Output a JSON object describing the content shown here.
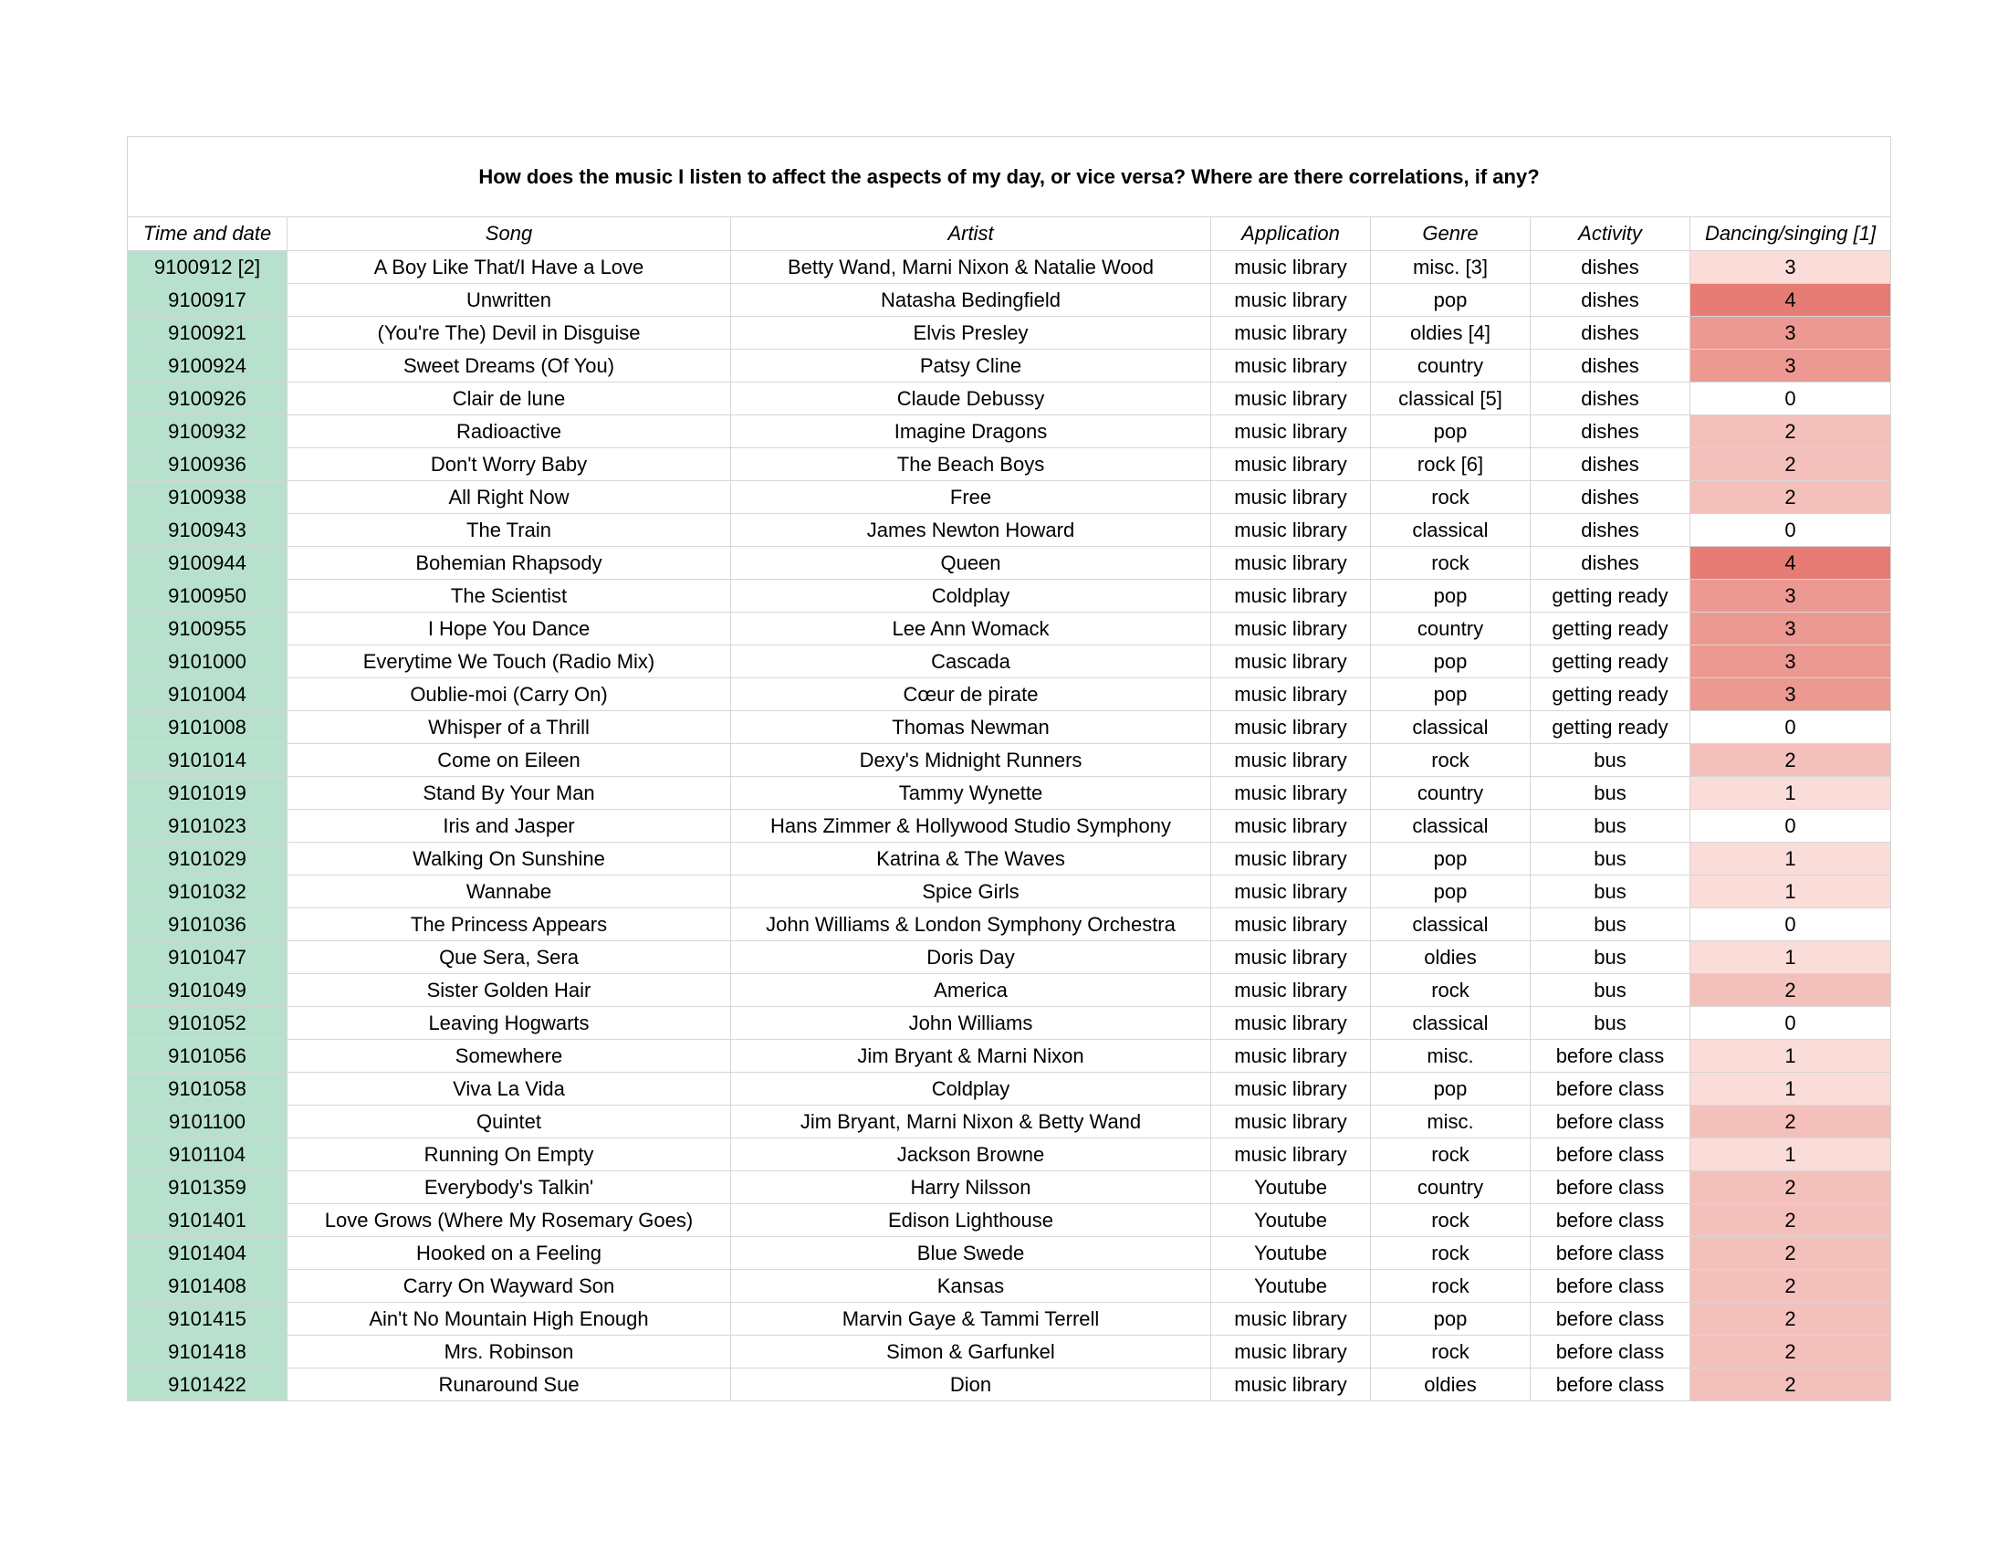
{
  "title": "How does the music I listen to affect the aspects of my day, or vice versa? Where are there correlations, if any?",
  "columns": [
    "Time and date",
    "Song",
    "Artist",
    "Application",
    "Genre",
    "Activity",
    "Dancing/singing [1]"
  ],
  "colors": {
    "time_column_fill": "#b7e1cd",
    "dance_scale": {
      "0": "#ffffff",
      "1": "#fadcd9",
      "2": "#f4c0bc",
      "3": "#ec9992",
      "4": "#e67c73"
    }
  },
  "rows": [
    {
      "time": "9100912 [2]",
      "song": "A Boy Like That/I Have a Love",
      "artist": "Betty Wand, Marni Nixon & Natalie Wood",
      "application": "music library",
      "genre": "misc. [3]",
      "activity": "dishes",
      "dance": 3,
      "dance_fill": "#fadcd9"
    },
    {
      "time": "9100917",
      "song": "Unwritten",
      "artist": "Natasha Bedingfield",
      "application": "music library",
      "genre": "pop",
      "activity": "dishes",
      "dance": 4,
      "dance_fill": "#e67c73"
    },
    {
      "time": "9100921",
      "song": "(You're The) Devil in Disguise",
      "artist": "Elvis Presley",
      "application": "music library",
      "genre": "oldies [4]",
      "activity": "dishes",
      "dance": 3,
      "dance_fill": "#ec9992"
    },
    {
      "time": "9100924",
      "song": "Sweet Dreams (Of You)",
      "artist": "Patsy Cline",
      "application": "music library",
      "genre": "country",
      "activity": "dishes",
      "dance": 3,
      "dance_fill": "#ec9992"
    },
    {
      "time": "9100926",
      "song": "Clair de lune",
      "artist": "Claude Debussy",
      "application": "music library",
      "genre": "classical [5]",
      "activity": "dishes",
      "dance": 0,
      "dance_fill": "#ffffff"
    },
    {
      "time": "9100932",
      "song": "Radioactive",
      "artist": "Imagine Dragons",
      "application": "music library",
      "genre": "pop",
      "activity": "dishes",
      "dance": 2,
      "dance_fill": "#f4c0bc"
    },
    {
      "time": "9100936",
      "song": "Don't Worry Baby",
      "artist": "The Beach Boys",
      "application": "music library",
      "genre": "rock [6]",
      "activity": "dishes",
      "dance": 2,
      "dance_fill": "#f4c0bc"
    },
    {
      "time": "9100938",
      "song": "All Right Now",
      "artist": "Free",
      "application": "music library",
      "genre": "rock",
      "activity": "dishes",
      "dance": 2,
      "dance_fill": "#f4c0bc"
    },
    {
      "time": "9100943",
      "song": "The Train",
      "artist": "James Newton Howard",
      "application": "music library",
      "genre": "classical",
      "activity": "dishes",
      "dance": 0,
      "dance_fill": "#ffffff"
    },
    {
      "time": "9100944",
      "song": "Bohemian Rhapsody",
      "artist": "Queen",
      "application": "music library",
      "genre": "rock",
      "activity": "dishes",
      "dance": 4,
      "dance_fill": "#e67c73"
    },
    {
      "time": "9100950",
      "song": "The Scientist",
      "artist": "Coldplay",
      "application": "music library",
      "genre": "pop",
      "activity": "getting ready",
      "dance": 3,
      "dance_fill": "#ec9992"
    },
    {
      "time": "9100955",
      "song": "I Hope You Dance",
      "artist": "Lee Ann Womack",
      "application": "music library",
      "genre": "country",
      "activity": "getting ready",
      "dance": 3,
      "dance_fill": "#ec9992"
    },
    {
      "time": "9101000",
      "song": "Everytime We Touch (Radio Mix)",
      "artist": "Cascada",
      "application": "music library",
      "genre": "pop",
      "activity": "getting ready",
      "dance": 3,
      "dance_fill": "#ec9992"
    },
    {
      "time": "9101004",
      "song": "Oublie-moi (Carry On)",
      "artist": "Cœur de pirate",
      "application": "music library",
      "genre": "pop",
      "activity": "getting ready",
      "dance": 3,
      "dance_fill": "#ec9992"
    },
    {
      "time": "9101008",
      "song": "Whisper of a Thrill",
      "artist": "Thomas Newman",
      "application": "music library",
      "genre": "classical",
      "activity": "getting ready",
      "dance": 0,
      "dance_fill": "#ffffff"
    },
    {
      "time": "9101014",
      "song": "Come on Eileen",
      "artist": "Dexy's Midnight Runners",
      "application": "music library",
      "genre": "rock",
      "activity": "bus",
      "dance": 2,
      "dance_fill": "#f4c0bc"
    },
    {
      "time": "9101019",
      "song": "Stand By Your Man",
      "artist": "Tammy Wynette",
      "application": "music library",
      "genre": "country",
      "activity": "bus",
      "dance": 1,
      "dance_fill": "#fadcd9"
    },
    {
      "time": "9101023",
      "song": "Iris and Jasper",
      "artist": "Hans Zimmer & Hollywood Studio Symphony",
      "application": "music library",
      "genre": "classical",
      "activity": "bus",
      "dance": 0,
      "dance_fill": "#ffffff"
    },
    {
      "time": "9101029",
      "song": "Walking On Sunshine",
      "artist": "Katrina & The Waves",
      "application": "music library",
      "genre": "pop",
      "activity": "bus",
      "dance": 1,
      "dance_fill": "#fadcd9"
    },
    {
      "time": "9101032",
      "song": "Wannabe",
      "artist": "Spice Girls",
      "application": "music library",
      "genre": "pop",
      "activity": "bus",
      "dance": 1,
      "dance_fill": "#fadcd9"
    },
    {
      "time": "9101036",
      "song": "The Princess Appears",
      "artist": "John Williams & London Symphony Orchestra",
      "application": "music library",
      "genre": "classical",
      "activity": "bus",
      "dance": 0,
      "dance_fill": "#ffffff"
    },
    {
      "time": "9101047",
      "song": "Que Sera, Sera",
      "artist": "Doris Day",
      "application": "music library",
      "genre": "oldies",
      "activity": "bus",
      "dance": 1,
      "dance_fill": "#fadcd9"
    },
    {
      "time": "9101049",
      "song": "Sister Golden Hair",
      "artist": "America",
      "application": "music library",
      "genre": "rock",
      "activity": "bus",
      "dance": 2,
      "dance_fill": "#f4c0bc"
    },
    {
      "time": "9101052",
      "song": "Leaving Hogwarts",
      "artist": "John Williams",
      "application": "music library",
      "genre": "classical",
      "activity": "bus",
      "dance": 0,
      "dance_fill": "#ffffff"
    },
    {
      "time": "9101056",
      "song": "Somewhere",
      "artist": "Jim Bryant & Marni Nixon",
      "application": "music library",
      "genre": "misc.",
      "activity": "before class",
      "dance": 1,
      "dance_fill": "#fadcd9"
    },
    {
      "time": "9101058",
      "song": "Viva La Vida",
      "artist": "Coldplay",
      "application": "music library",
      "genre": "pop",
      "activity": "before class",
      "dance": 1,
      "dance_fill": "#fadcd9"
    },
    {
      "time": "9101100",
      "song": "Quintet",
      "artist": "Jim Bryant, Marni Nixon & Betty Wand",
      "application": "music library",
      "genre": "misc.",
      "activity": "before class",
      "dance": 2,
      "dance_fill": "#f4c0bc"
    },
    {
      "time": "9101104",
      "song": "Running On Empty",
      "artist": "Jackson Browne",
      "application": "music library",
      "genre": "rock",
      "activity": "before class",
      "dance": 1,
      "dance_fill": "#fadcd9"
    },
    {
      "time": "9101359",
      "song": "Everybody's Talkin'",
      "artist": "Harry Nilsson",
      "application": "Youtube",
      "genre": "country",
      "activity": "before class",
      "dance": 2,
      "dance_fill": "#f4c0bc"
    },
    {
      "time": "9101401",
      "song": "Love Grows (Where My Rosemary Goes)",
      "artist": "Edison Lighthouse",
      "application": "Youtube",
      "genre": "rock",
      "activity": "before class",
      "dance": 2,
      "dance_fill": "#f4c0bc"
    },
    {
      "time": "9101404",
      "song": "Hooked on a Feeling",
      "artist": "Blue Swede",
      "application": "Youtube",
      "genre": "rock",
      "activity": "before class",
      "dance": 2,
      "dance_fill": "#f4c0bc"
    },
    {
      "time": "9101408",
      "song": "Carry On Wayward Son",
      "artist": "Kansas",
      "application": "Youtube",
      "genre": "rock",
      "activity": "before class",
      "dance": 2,
      "dance_fill": "#f4c0bc"
    },
    {
      "time": "9101415",
      "song": "Ain't No Mountain High Enough",
      "artist": "Marvin Gaye & Tammi Terrell",
      "application": "music library",
      "genre": "pop",
      "activity": "before class",
      "dance": 2,
      "dance_fill": "#f4c0bc"
    },
    {
      "time": "9101418",
      "song": "Mrs. Robinson",
      "artist": "Simon & Garfunkel",
      "application": "music library",
      "genre": "rock",
      "activity": "before class",
      "dance": 2,
      "dance_fill": "#f4c0bc"
    },
    {
      "time": "9101422",
      "song": "Runaround Sue",
      "artist": "Dion",
      "application": "music library",
      "genre": "oldies",
      "activity": "before class",
      "dance": 2,
      "dance_fill": "#f4c0bc"
    }
  ]
}
